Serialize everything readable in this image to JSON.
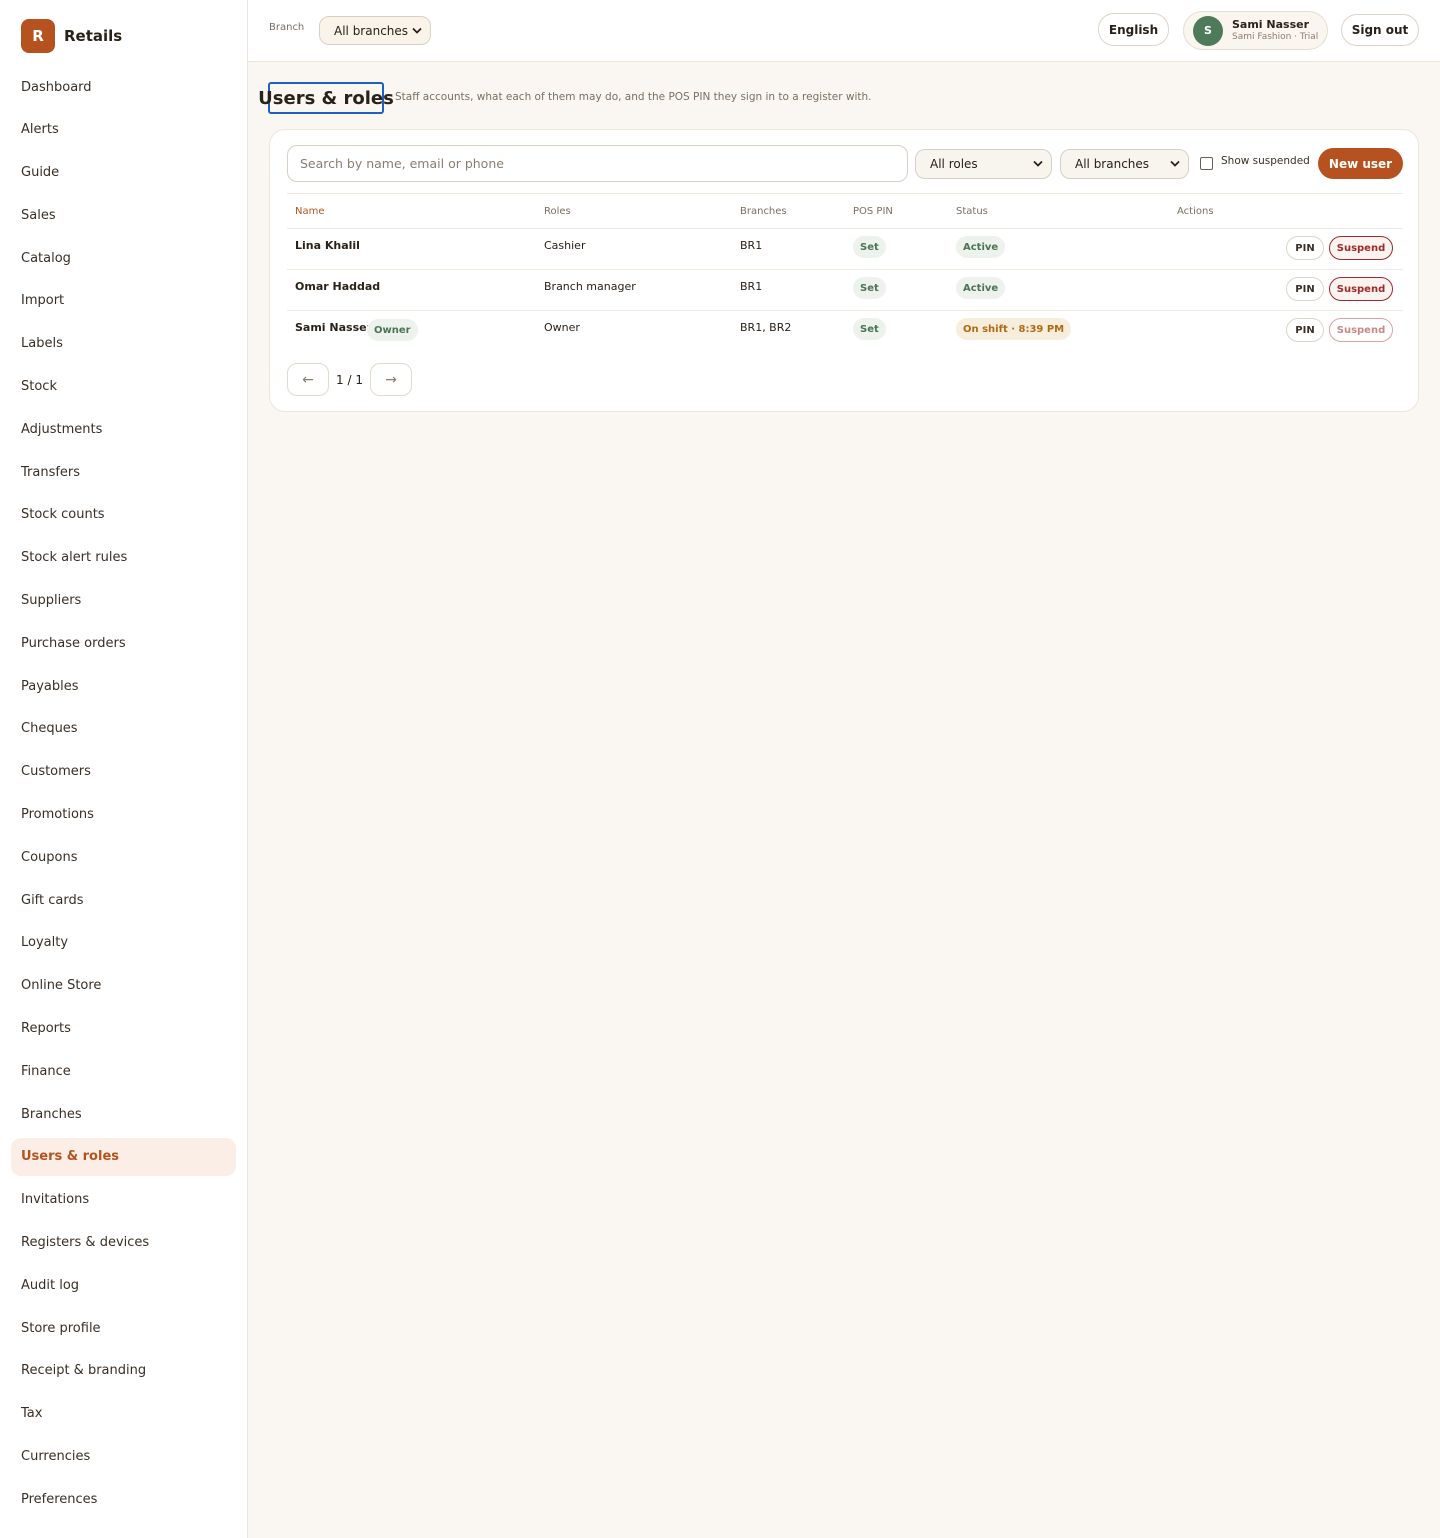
{
  "brand": {
    "logo_letter": "R",
    "name": "Retails"
  },
  "sidebar": {
    "items": [
      {
        "label": "Dashboard"
      },
      {
        "label": "Alerts"
      },
      {
        "label": "Guide"
      },
      {
        "label": "Sales"
      },
      {
        "label": "Catalog"
      },
      {
        "label": "Import"
      },
      {
        "label": "Labels"
      },
      {
        "label": "Stock"
      },
      {
        "label": "Adjustments"
      },
      {
        "label": "Transfers"
      },
      {
        "label": "Stock counts"
      },
      {
        "label": "Stock alert rules"
      },
      {
        "label": "Suppliers"
      },
      {
        "label": "Purchase orders"
      },
      {
        "label": "Payables"
      },
      {
        "label": "Cheques"
      },
      {
        "label": "Customers"
      },
      {
        "label": "Promotions"
      },
      {
        "label": "Coupons"
      },
      {
        "label": "Gift cards"
      },
      {
        "label": "Loyalty"
      },
      {
        "label": "Online Store"
      },
      {
        "label": "Reports"
      },
      {
        "label": "Finance"
      },
      {
        "label": "Branches"
      },
      {
        "label": "Users & roles",
        "active": true
      },
      {
        "label": "Invitations"
      },
      {
        "label": "Registers & devices"
      },
      {
        "label": "Audit log"
      },
      {
        "label": "Store profile"
      },
      {
        "label": "Receipt & branding"
      },
      {
        "label": "Tax"
      },
      {
        "label": "Currencies"
      },
      {
        "label": "Preferences"
      }
    ]
  },
  "topbar": {
    "branch_label": "Branch",
    "branch_value": "All branches",
    "language_label": "English",
    "user": {
      "initial": "S",
      "name": "Sami Nasser",
      "org": "Sami Fashion · Trial"
    },
    "signout_label": "Sign out"
  },
  "page": {
    "title": "Users & roles",
    "subtitle": "Staff accounts, what each of them may do, and the POS PIN they sign in to a register with."
  },
  "filters": {
    "search_placeholder": "Search by name, email or phone",
    "roles_value": "All roles",
    "branches_value": "All branches",
    "show_suspended_label": "Show suspended",
    "new_user_label": "New user"
  },
  "table": {
    "headers": {
      "name": "Name",
      "roles": "Roles",
      "branches": "Branches",
      "pos_pin": "POS PIN",
      "status": "Status",
      "actions": "Actions"
    },
    "rows": [
      {
        "name": "Lina Khalil",
        "owner_badge": "",
        "roles": "Cashier",
        "branches": "BR1",
        "pos_pin": "Set",
        "status": "Active",
        "status_kind": "green",
        "pin_label": "PIN",
        "suspend_label": "Suspend",
        "suspend_disabled": false
      },
      {
        "name": "Omar Haddad",
        "owner_badge": "",
        "roles": "Branch manager",
        "branches": "BR1",
        "pos_pin": "Set",
        "status": "Active",
        "status_kind": "green",
        "pin_label": "PIN",
        "suspend_label": "Suspend",
        "suspend_disabled": false
      },
      {
        "name": "Sami Nasser",
        "owner_badge": "Owner",
        "roles": "Owner",
        "branches": "BR1, BR2",
        "pos_pin": "Set",
        "status": "On shift · 8:39 PM",
        "status_kind": "amber",
        "pin_label": "PIN",
        "suspend_label": "Suspend",
        "suspend_disabled": true
      }
    ]
  },
  "pager": {
    "prev_icon": "←",
    "label": "1 / 1",
    "next_icon": "→"
  },
  "colors": {
    "accent": "#b5521f",
    "success": "#4a7553",
    "danger": "#9e2a2a",
    "focus": "#1f5fbf"
  }
}
